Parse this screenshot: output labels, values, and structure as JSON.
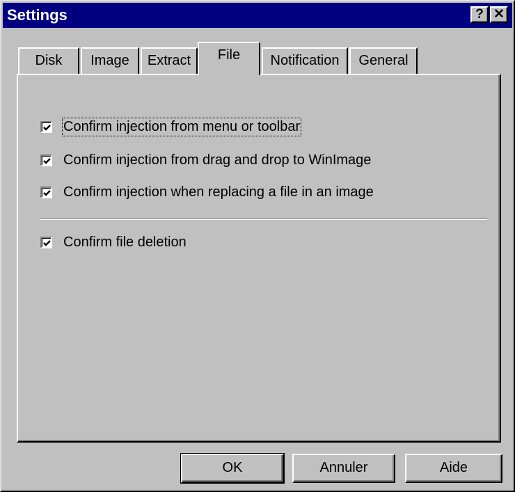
{
  "window": {
    "title": "Settings",
    "help_glyph": "?",
    "close_glyph": "✕"
  },
  "tabs": [
    {
      "label": "Disk",
      "active": false
    },
    {
      "label": "Image",
      "active": false
    },
    {
      "label": "Extract",
      "active": false
    },
    {
      "label": "File",
      "active": true
    },
    {
      "label": "Notification",
      "active": false
    },
    {
      "label": "General",
      "active": false
    }
  ],
  "file_tab": {
    "options": [
      {
        "label": "Confirm injection from menu or toolbar",
        "checked": true,
        "focused": true
      },
      {
        "label": "Confirm injection from drag and drop to WinImage",
        "checked": true
      },
      {
        "label": "Confirm injection when replacing a file in an image",
        "checked": true
      },
      {
        "label": "Confirm file deletion",
        "checked": true
      }
    ]
  },
  "buttons": {
    "ok": "OK",
    "cancel": "Annuler",
    "help": "Aide"
  }
}
